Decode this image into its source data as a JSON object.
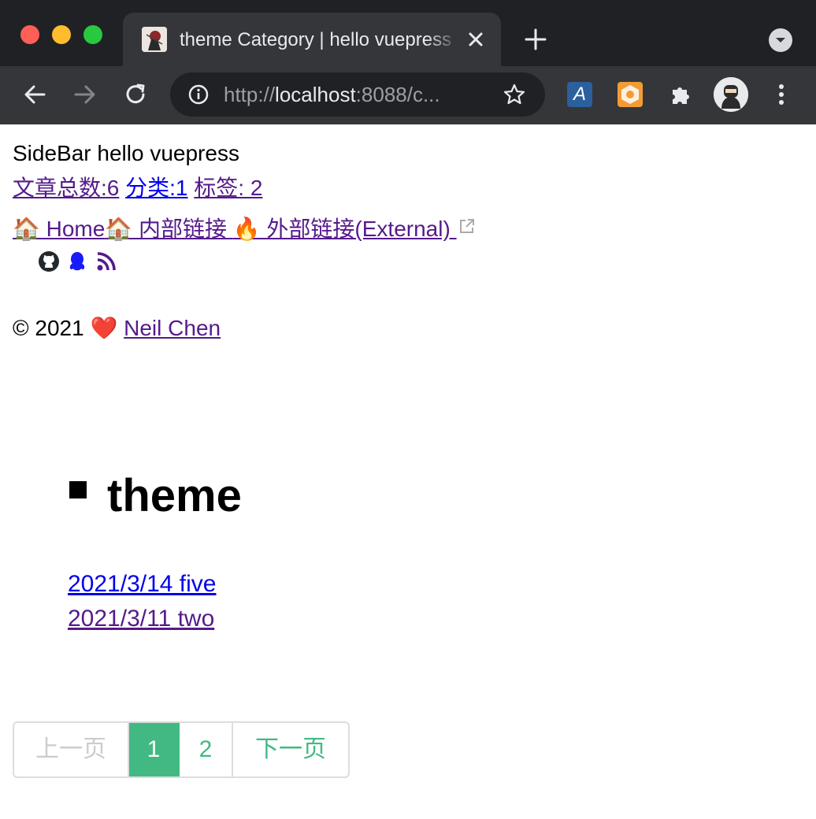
{
  "browser": {
    "tab_title": "theme Category | hello vuepress",
    "url_scheme": "http://",
    "url_host": "localhost",
    "url_rest": ":8088/c...",
    "extension_translate_glyph": "A",
    "icons": [
      "back-icon",
      "forward-icon",
      "reload-icon",
      "info-icon",
      "star-icon",
      "puzzle-icon",
      "kebab-icon",
      "close-icon",
      "plus-icon"
    ]
  },
  "sidebar": {
    "title": "SideBar hello vuepress",
    "stats": {
      "articles": "文章总数:6",
      "categories": "分类:1",
      "tags": "标签: 2"
    },
    "nav": {
      "home": "🏠 Home",
      "internal": "🏠 内部链接 ",
      "external": "🔥 外部链接(External) "
    },
    "social_icons": [
      "github-icon",
      "qq-icon",
      "rss-icon"
    ],
    "footer": {
      "prefix": "© 2021 ",
      "heart": "❤️",
      "author": "Neil Chen"
    }
  },
  "main": {
    "category_title": "theme",
    "posts": [
      {
        "label": "2021/3/14 five"
      },
      {
        "label": "2021/3/11 two"
      }
    ],
    "pagination": {
      "prev": "上一页",
      "pages": [
        "1",
        "2"
      ],
      "current": "1",
      "next": "下一页"
    }
  },
  "colors": {
    "accent": "#42b983",
    "link": "#0000ee",
    "visited": "#551a8b",
    "chrome_dark": "#202124",
    "chrome_toolbar": "#35363a"
  }
}
